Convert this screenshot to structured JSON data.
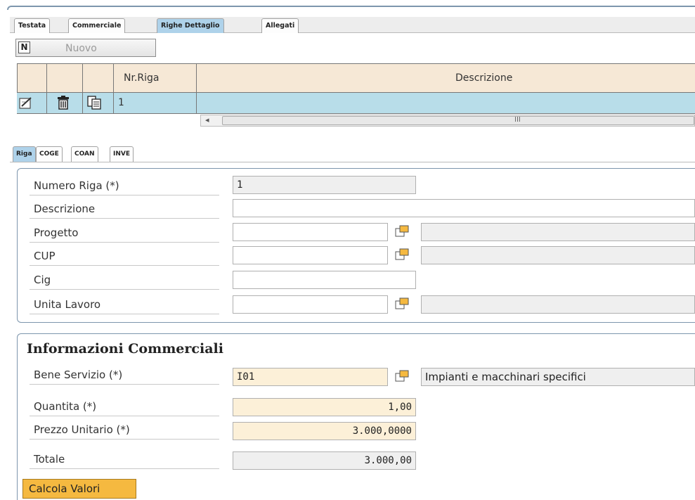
{
  "top_tabs": [
    {
      "label": "Testata",
      "active": false
    },
    {
      "label": "Commerciale",
      "active": false
    },
    {
      "label": "Righe Dettaglio",
      "active": true
    },
    {
      "label": "Allegati",
      "active": false
    }
  ],
  "toolbar": {
    "new_label": "Nuovo",
    "new_icon": "new-document-icon"
  },
  "grid": {
    "columns": [
      "",
      "",
      "",
      "Nr.Riga",
      "Descrizione"
    ],
    "rows": [
      {
        "nr_riga": "1",
        "descrizione": ""
      }
    ],
    "row_icons": [
      "edit-icon",
      "delete-icon",
      "copy-icon"
    ],
    "header_bg": "#f6e8d6",
    "selected_row_bg": "#b8dde9",
    "scroll_indicator": "III"
  },
  "sub_tabs": [
    {
      "label": "Riga",
      "active": true
    },
    {
      "label": "COGE",
      "active": false
    },
    {
      "label": "COAN",
      "active": false
    },
    {
      "label": "INVE",
      "active": false
    }
  ],
  "riga": {
    "numero_riga": {
      "label": "Numero Riga (*)",
      "value": "1"
    },
    "descrizione": {
      "label": "Descrizione",
      "value": ""
    },
    "progetto": {
      "label": "Progetto",
      "value": "",
      "desc": ""
    },
    "cup": {
      "label": "CUP",
      "value": "",
      "desc": ""
    },
    "cig": {
      "label": "Cig",
      "value": ""
    },
    "unita_lavoro": {
      "label": "Unita Lavoro",
      "value": "",
      "desc": ""
    }
  },
  "commerciali": {
    "title": "Informazioni Commerciali",
    "bene_servizio": {
      "label": "Bene Servizio (*)",
      "value": "I01",
      "desc": "Impianti e macchinari specifici"
    },
    "quantita": {
      "label": "Quantita (*)",
      "value": "1,00"
    },
    "prezzo_unitario": {
      "label": "Prezzo Unitario (*)",
      "value": "3.000,0000"
    },
    "totale": {
      "label": "Totale",
      "value": "3.000,00"
    },
    "calcola_label": "Calcola Valori"
  },
  "colors": {
    "accent": "#aed2ea",
    "required_bg": "#fcf0d8",
    "button": "#f5b940"
  }
}
